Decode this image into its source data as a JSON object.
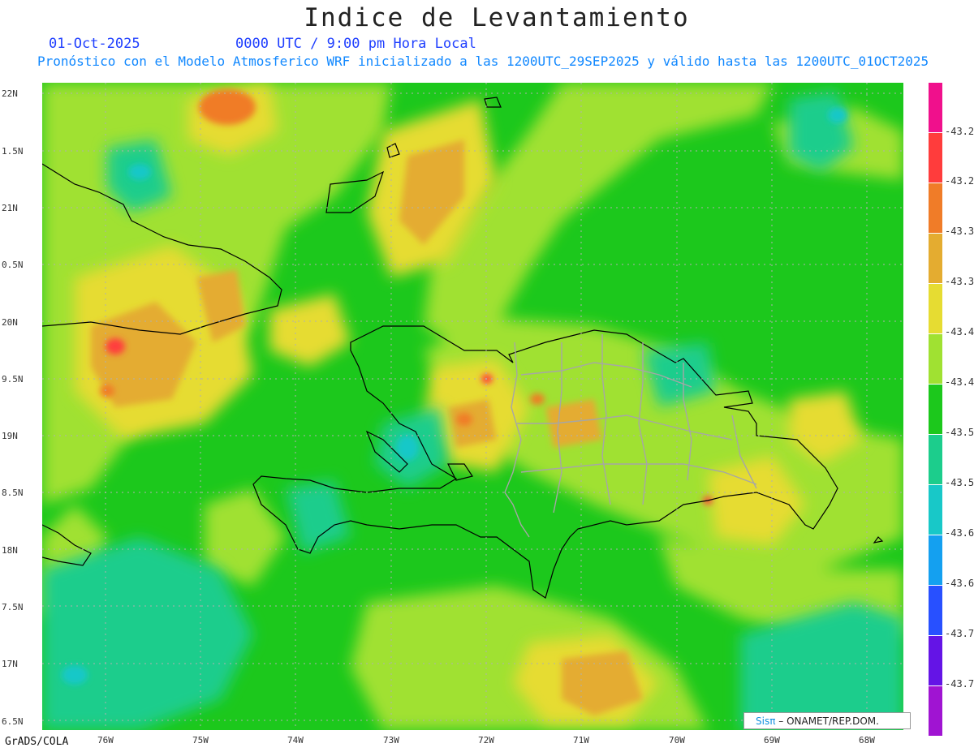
{
  "header": {
    "title": "Indice de Levantamiento",
    "date": "01-Oct-2025",
    "time": "0000 UTC / 9:00 pm Hora Local",
    "model_line": "Pronóstico con el Modelo Atmosferico WRF inicializado a las 1200UTC_29SEP2025 y válido hasta las  1200UTC_01OCT2025"
  },
  "axes": {
    "y_ticks": [
      "22N",
      "1.5N",
      "21N",
      "0.5N",
      "20N",
      "9.5N",
      "19N",
      "8.5N",
      "18N",
      "7.5N",
      "17N",
      "6.5N"
    ],
    "x_ticks": [
      "76W",
      "75W",
      "74W",
      "73W",
      "72W",
      "71W",
      "70W",
      "69W",
      "68W"
    ]
  },
  "colorbar": {
    "colors": [
      "#f0108c",
      "#ff3c3c",
      "#f07c28",
      "#e4ac30",
      "#e6dc32",
      "#a0e132",
      "#1cc81c",
      "#1ccd8c",
      "#18c8c8",
      "#14a0f0",
      "#2850ff",
      "#6414e6",
      "#a014d2"
    ],
    "labels": [
      "-43.2",
      "-43.2",
      "-43.3",
      "-43.3",
      "-43.4",
      "-43.4",
      "-43.5",
      "-43.5",
      "-43.6",
      "-43.6",
      "-43.7",
      "-43.7"
    ]
  },
  "footer": {
    "grads": "GrADS/COLA",
    "credit_logo": "Sisπ",
    "credit_text": " – ONAMET/REP.DOM."
  },
  "map_layers": [
    "lifted-index-field",
    "coastline",
    "dominican-provinces",
    "lat-lon-grid"
  ]
}
